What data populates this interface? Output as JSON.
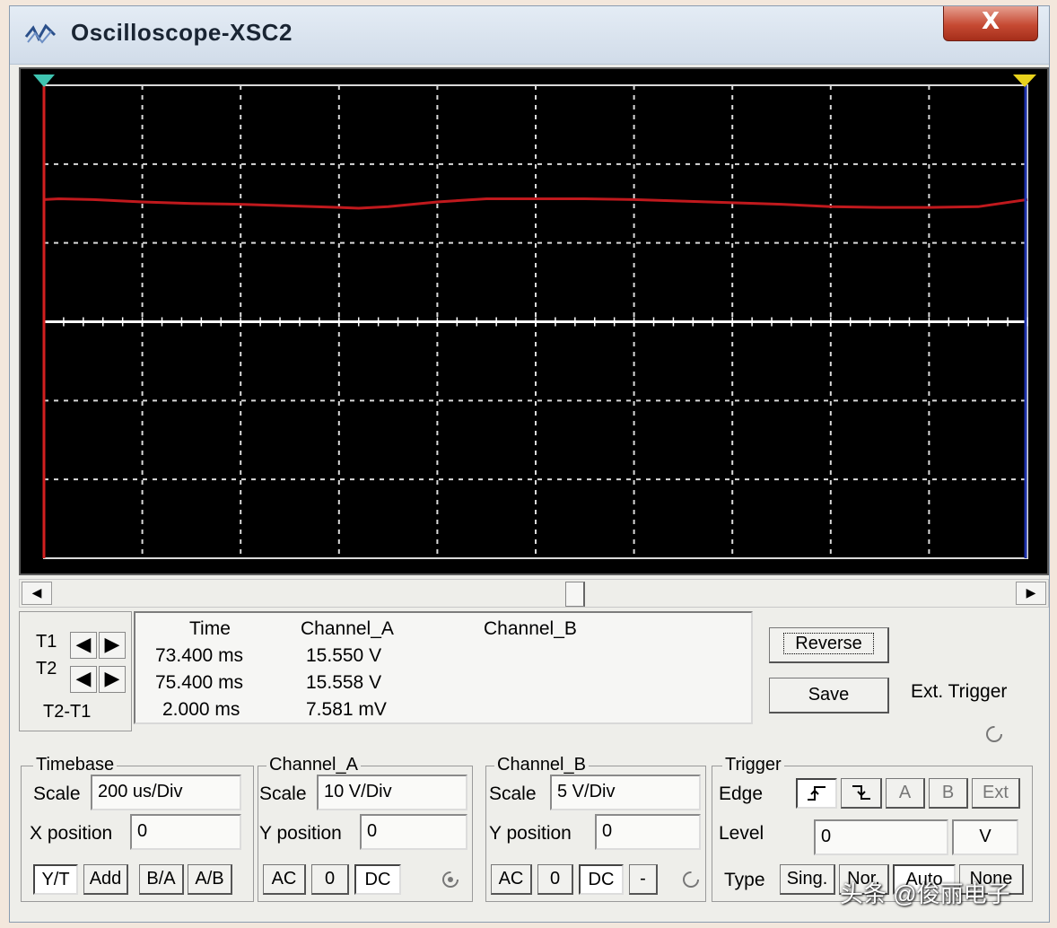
{
  "window": {
    "title": "Oscilloscope-XSC2",
    "close_label": "X"
  },
  "screen": {
    "background": "#000000",
    "grid_color": "#d9d9d9",
    "trace_a_color": "#c0191d",
    "cursor1_color": "#d21f1f",
    "cursor2_color": "#1b2fa8",
    "cursor1_marker_color": "#3fc4b1",
    "cursor2_marker_color": "#e8d21c",
    "divisions_x": 10,
    "divisions_y": 6
  },
  "chart_data": {
    "type": "line",
    "title": "",
    "xlabel": "",
    "ylabel": "",
    "x_divisions": 10,
    "y_divisions": 6,
    "series": [
      {
        "x_div": [
          0.0,
          0.15,
          0.5,
          1.0,
          1.5,
          2.0,
          2.5,
          3.0,
          3.2,
          3.5,
          4.0,
          4.5,
          5.0,
          5.5,
          6.0,
          6.5,
          7.0,
          7.5,
          8.0,
          8.5,
          9.0,
          9.5,
          10.0
        ],
        "y_div": [
          1.55,
          1.56,
          1.55,
          1.52,
          1.5,
          1.49,
          1.47,
          1.45,
          1.44,
          1.46,
          1.52,
          1.56,
          1.56,
          1.56,
          1.55,
          1.53,
          1.51,
          1.49,
          1.46,
          1.45,
          1.45,
          1.46,
          1.55
        ]
      }
    ]
  },
  "scrollbar": {
    "left_arrow": "◀",
    "right_arrow": "▶"
  },
  "cursors": {
    "t1_label": "T1",
    "t2_label": "T2",
    "diff_label": "T2-T1",
    "left_arrow": "◀",
    "right_arrow": "▶"
  },
  "readout": {
    "headers": [
      "Time",
      "Channel_A",
      "Channel_B"
    ],
    "rows": [
      [
        "73.400 ms",
        "15.550 V",
        ""
      ],
      [
        "75.400 ms",
        "15.558 V",
        ""
      ],
      [
        "2.000 ms",
        "7.581 mV",
        ""
      ]
    ]
  },
  "buttons": {
    "reverse": "Reverse",
    "save": "Save",
    "ext_trigger": "Ext. Trigger"
  },
  "timebase": {
    "title": "Timebase",
    "scale_label": "Scale",
    "scale_value": "200 us/Div",
    "xpos_label": "X position",
    "xpos_value": "0",
    "modes": [
      "Y/T",
      "Add",
      "B/A",
      "A/B"
    ]
  },
  "channel_a": {
    "title": "Channel_A",
    "scale_label": "Scale",
    "scale_value": "10  V/Div",
    "ypos_label": "Y position",
    "ypos_value": "0",
    "coupling": [
      "AC",
      "0",
      "DC"
    ]
  },
  "channel_b": {
    "title": "Channel_B",
    "scale_label": "Scale",
    "scale_value": "5  V/Div",
    "ypos_label": "Y position",
    "ypos_value": "0",
    "coupling": [
      "AC",
      "0",
      "DC",
      "-"
    ]
  },
  "trigger": {
    "title": "Trigger",
    "edge_label": "Edge",
    "edge_buttons": [
      "A",
      "B",
      "Ext"
    ],
    "level_label": "Level",
    "level_value": "0",
    "level_unit": "V",
    "type_label": "Type",
    "type_options": [
      "Sing.",
      "Nor.",
      "Auto",
      "None"
    ]
  },
  "watermark": "头条 @俊丽电子"
}
